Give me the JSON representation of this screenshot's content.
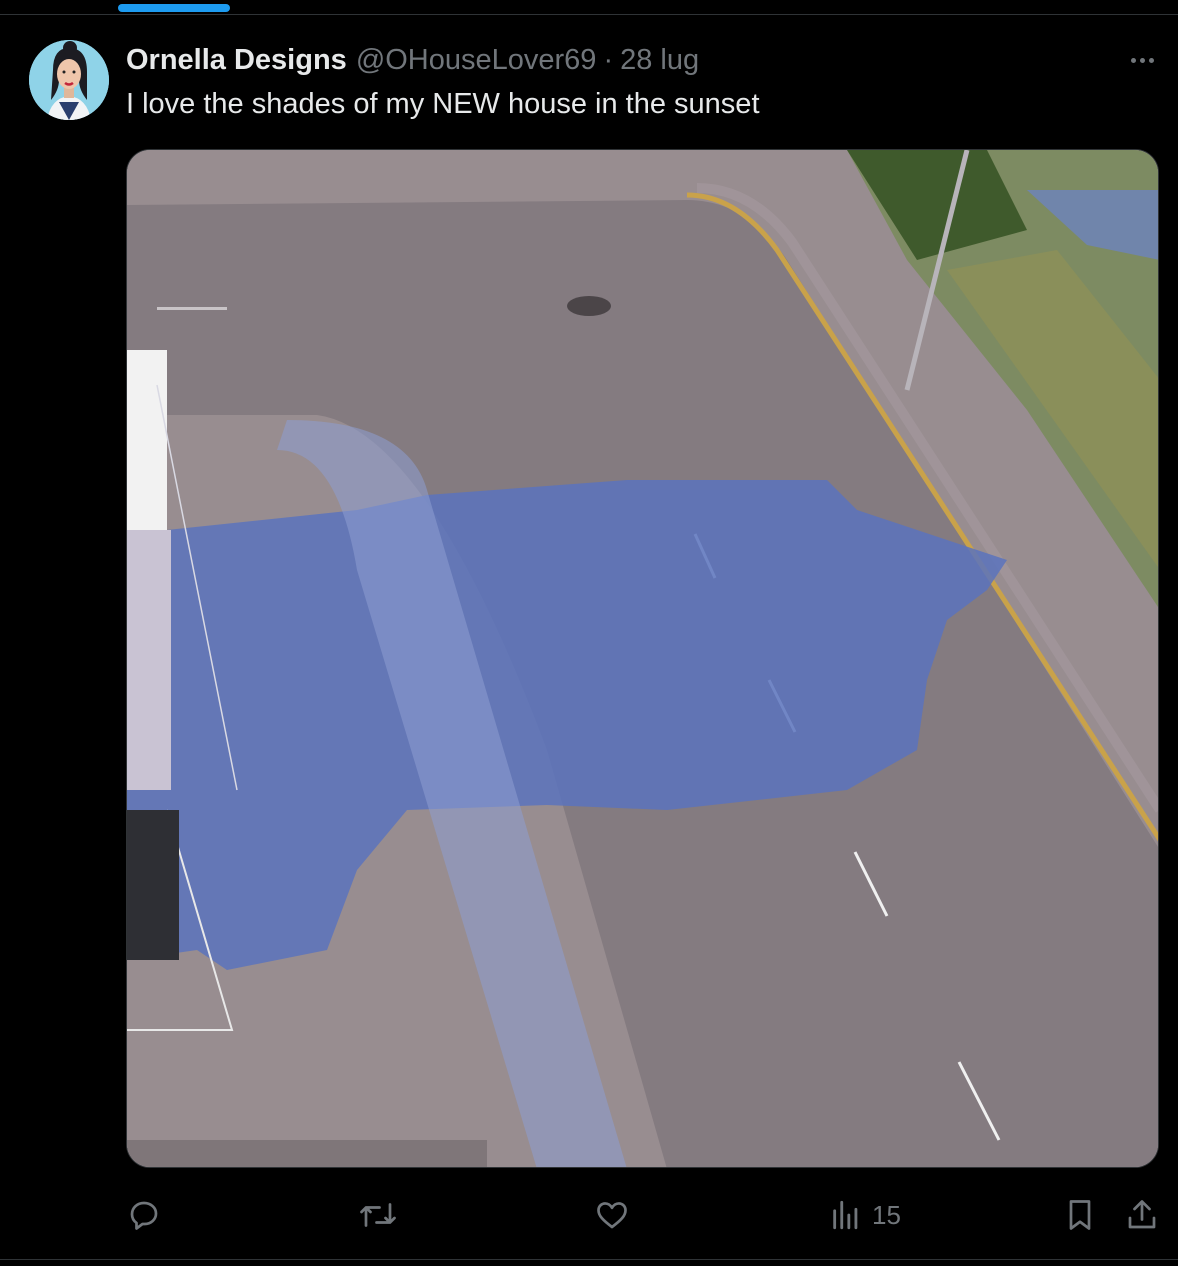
{
  "tweet": {
    "author_name": "Ornella Designs",
    "handle": "@OHouseLover69",
    "separator": "·",
    "date": "28 lug",
    "text": "I love the shades of my NEW house in the sunset"
  },
  "metrics": {
    "views": "15"
  },
  "icons": {
    "more": "more-icon",
    "reply": "reply-icon",
    "retweet": "retweet-icon",
    "like": "heart-icon",
    "views": "views-icon",
    "bookmark": "bookmark-icon",
    "share": "share-icon"
  },
  "colors": {
    "background": "#000000",
    "primary_text": "#e7e9ea",
    "secondary_text": "#71767b",
    "accent": "#1d9bf0",
    "divider": "#2f3336"
  }
}
